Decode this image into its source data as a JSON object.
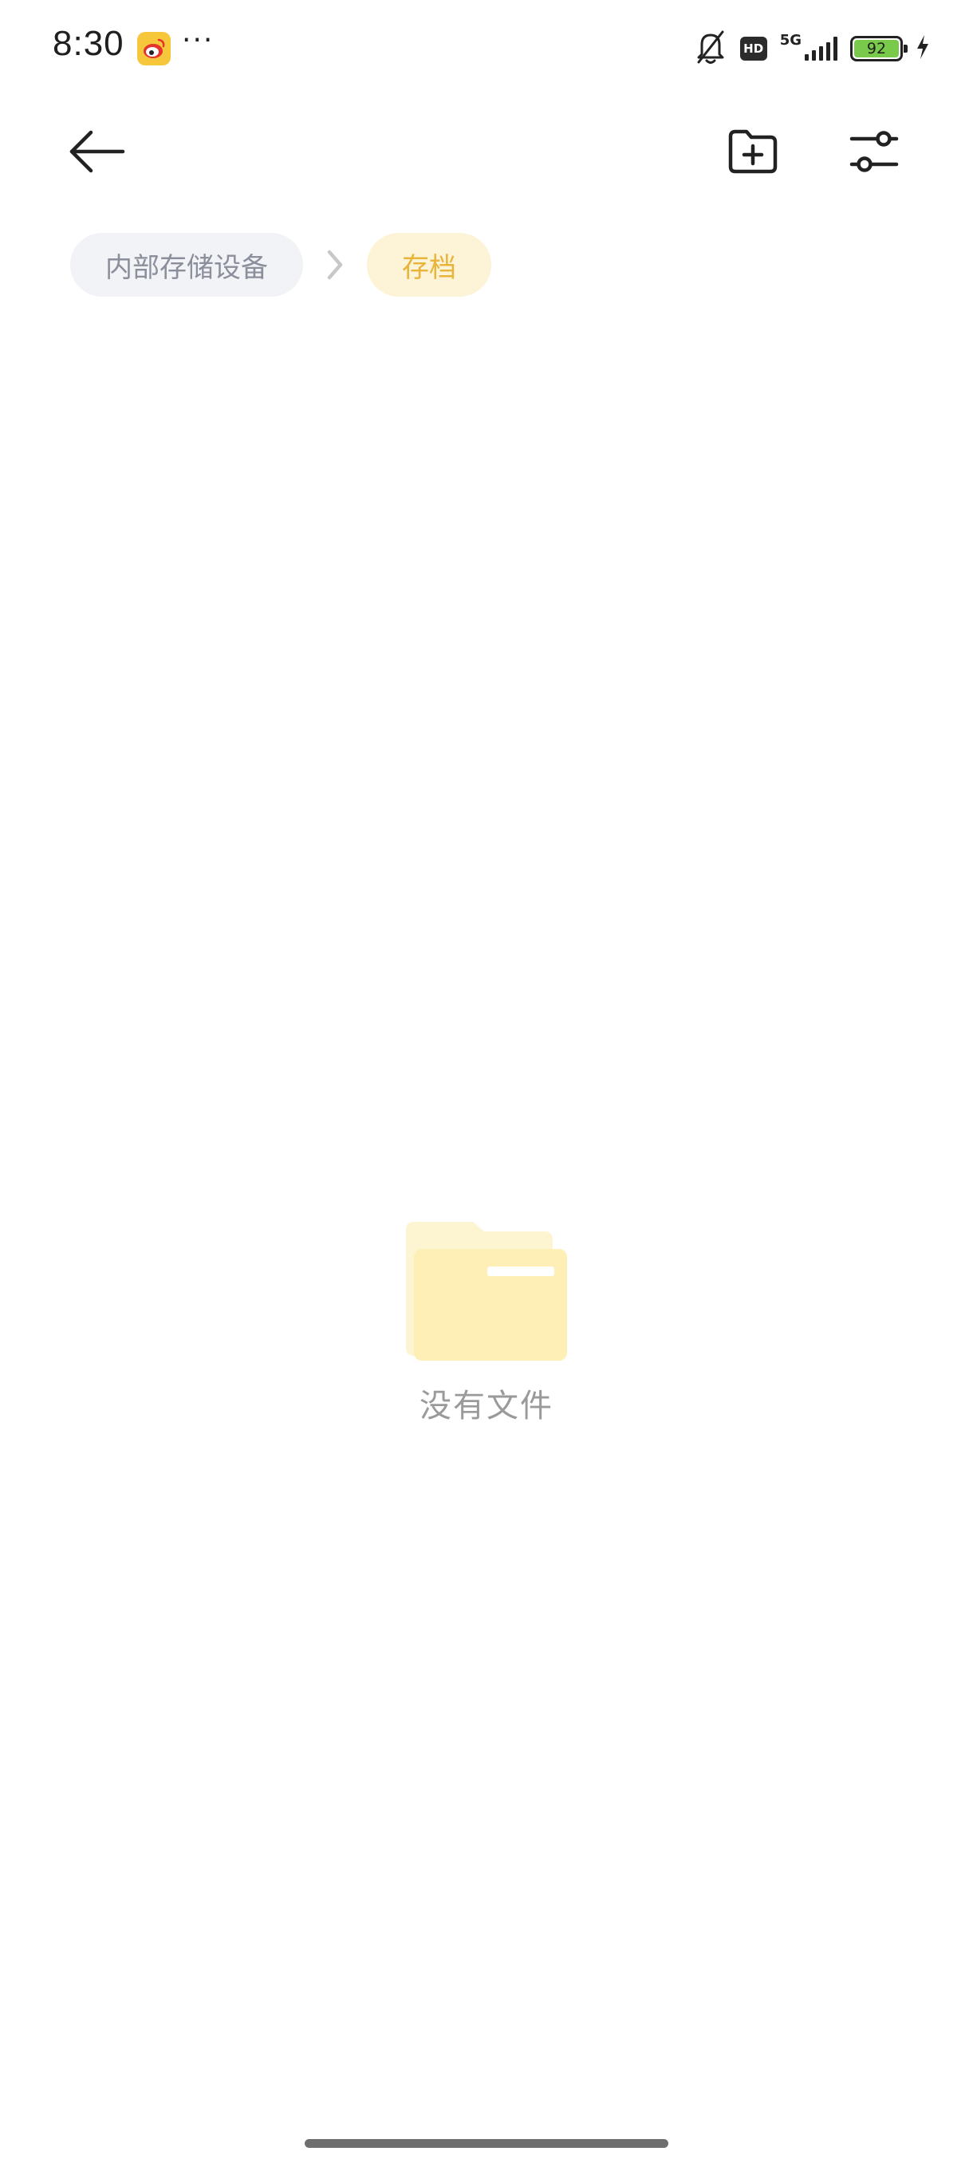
{
  "status_bar": {
    "time": "8:30",
    "more_indicator": "···",
    "hd_label": "HD",
    "network_label": "5G",
    "battery_level": "92",
    "icons": [
      "weibo-app-icon",
      "bell-off-icon",
      "signal-icon",
      "battery-icon",
      "charging-bolt-icon"
    ]
  },
  "toolbar": {
    "back_icon": "arrow-left-icon",
    "new_folder_icon": "folder-plus-icon",
    "filter_icon": "sliders-icon"
  },
  "breadcrumb": {
    "items": [
      {
        "label": "内部存储设备"
      },
      {
        "label": "存档"
      }
    ],
    "separator_icon": "chevron-right-icon"
  },
  "empty_state": {
    "icon": "folder-icon",
    "text": "没有文件"
  },
  "colors": {
    "accent": "#e8b43a",
    "accent_bg": "#fdf3d6",
    "crumb_bg": "#f2f3f6",
    "crumb_text": "#8a8f9b",
    "battery_fill": "#79c94a",
    "empty_text": "#9a9a9a"
  }
}
